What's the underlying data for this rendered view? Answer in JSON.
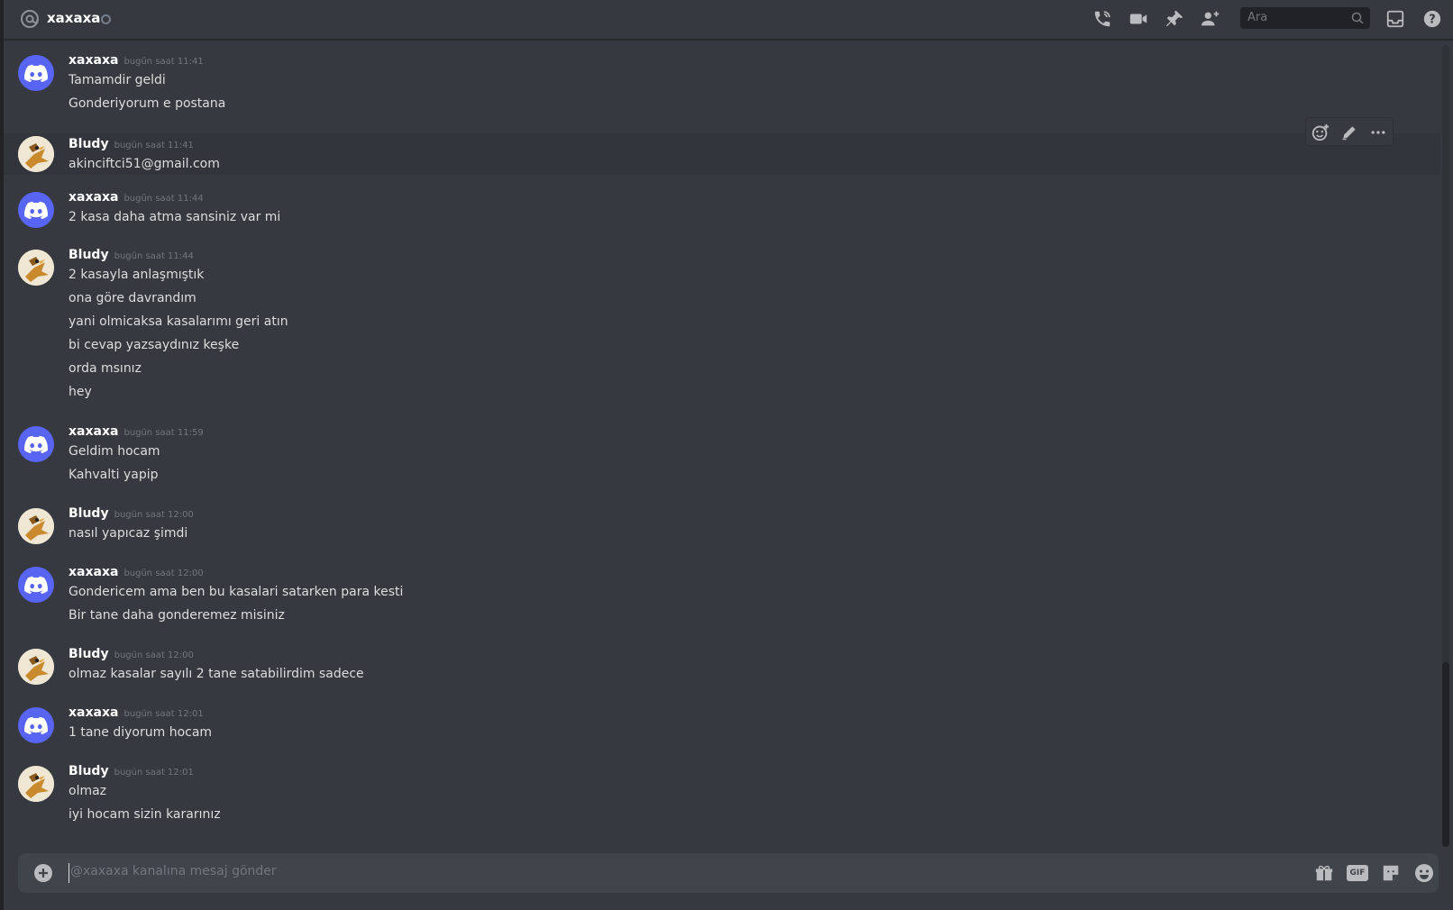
{
  "header": {
    "title": "xaxaxa",
    "search_placeholder": "Ara",
    "icons": [
      "at-icon",
      "voice-call-icon",
      "video-call-icon",
      "pinned-messages-icon",
      "add-friend-icon",
      "search-icon",
      "inbox-icon",
      "help-icon"
    ]
  },
  "messages": [
    {
      "author": "xaxaxa",
      "timestamp": "bugün saat 11:41",
      "avatar": "discord-default",
      "lines": [
        "Tamamdir geldi",
        "Gonderiyorum e postana"
      ]
    },
    {
      "author": "Bludy",
      "timestamp": "bugün saat 11:41",
      "avatar": "bird",
      "lines": [
        "akinciftci51@gmail.com"
      ]
    },
    {
      "author": "xaxaxa",
      "timestamp": "bugün saat 11:44",
      "avatar": "discord-default",
      "lines": [
        "2 kasa daha atma sansiniz var mi"
      ]
    },
    {
      "author": "Bludy",
      "timestamp": "bugün saat 11:44",
      "avatar": "bird",
      "lines": [
        "2 kasayla anlaşmıştık",
        "ona göre davrandım",
        "yani olmicaksa kasalarımı geri atın",
        "bi cevap yazsaydınız keşke",
        "orda msınız",
        "hey"
      ]
    },
    {
      "author": "xaxaxa",
      "timestamp": "bugün saat 11:59",
      "avatar": "discord-default",
      "lines": [
        "Geldim hocam",
        "Kahvalti yapip"
      ]
    },
    {
      "author": "Bludy",
      "timestamp": "bugün saat 12:00",
      "avatar": "bird",
      "lines": [
        "nasıl yapıcaz şimdi"
      ]
    },
    {
      "author": "xaxaxa",
      "timestamp": "bugün saat 12:00",
      "avatar": "discord-default",
      "lines": [
        "Gondericem ama ben bu kasalari satarken para kesti",
        "Bir tane daha gonderemez misiniz"
      ]
    },
    {
      "author": "Bludy",
      "timestamp": "bugün saat 12:00",
      "avatar": "bird",
      "lines": [
        "olmaz kasalar sayılı 2 tane satabilirdim sadece"
      ]
    },
    {
      "author": "xaxaxa",
      "timestamp": "bugün saat 12:01",
      "avatar": "discord-default",
      "lines": [
        "1 tane diyorum hocam"
      ]
    },
    {
      "author": "Bludy",
      "timestamp": "bugün saat 12:01",
      "avatar": "bird",
      "lines": [
        "olmaz",
        "iyi hocam sizin kararınız"
      ]
    }
  ],
  "hover_toolbar": {
    "icons": [
      "add-reaction-icon",
      "edit-icon",
      "more-icon"
    ]
  },
  "composer": {
    "placeholder": "@xaxaxa kanalına mesaj gönder",
    "icons": [
      "add-attachment-icon",
      "gift-icon",
      "gif-icon",
      "sticker-icon",
      "emoji-icon"
    ],
    "gif_label": "GIF"
  },
  "colors": {
    "background": "#36393f",
    "blurple": "#5865f2",
    "header_text": "#ffffff",
    "muted": "#72767d"
  }
}
